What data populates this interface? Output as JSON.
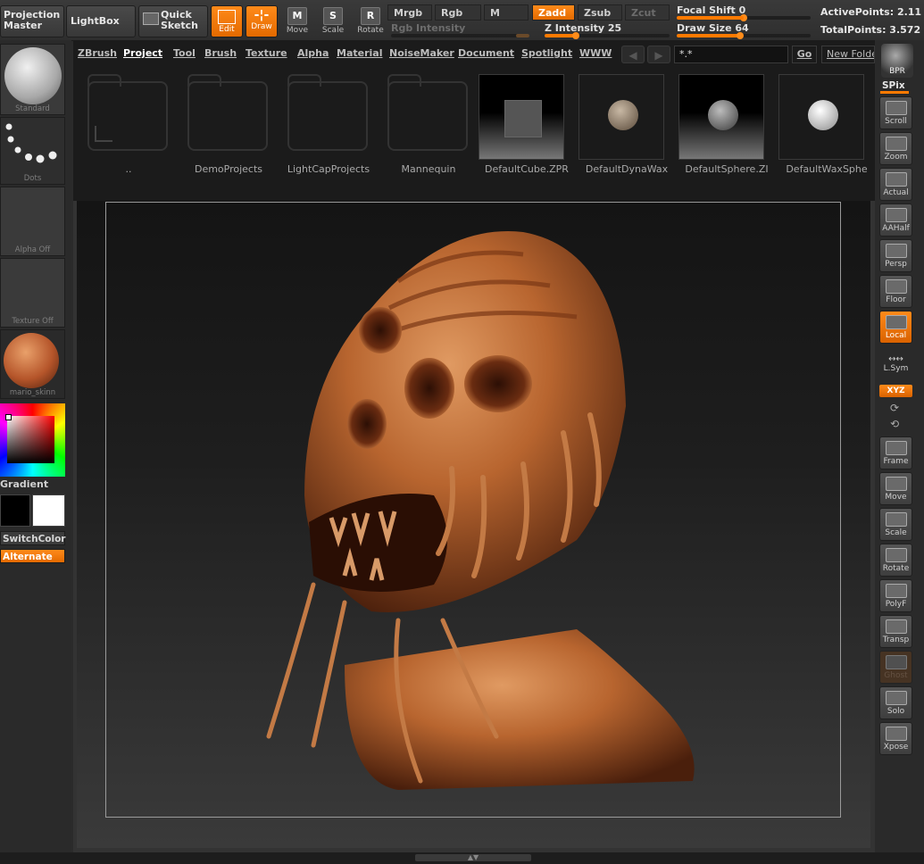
{
  "topbar": {
    "projection_master": "Projection\nMaster",
    "lightbox": "LightBox",
    "quick_sketch": "Quick\nSketch",
    "edit": "Edit",
    "draw": "Draw",
    "move": "Move",
    "scale": "Scale",
    "rotate": "Rotate",
    "move_ic": "M",
    "scale_ic": "S",
    "rotate_ic": "R",
    "mrgb": "Mrgb",
    "rgb": "Rgb",
    "m": "M",
    "zadd": "Zadd",
    "zsub": "Zsub",
    "zcut": "Zcut",
    "rgb_intensity": "Rgb Intensity",
    "z_intensity": "Z Intensity 25",
    "focal_shift": "Focal Shift 0",
    "draw_size": "Draw Size 64",
    "z_intensity_value": 25,
    "focal_shift_value": 0,
    "draw_size_value": 64,
    "active_points": "ActivePoints: 2.11",
    "total_points": "TotalPoints: 3.572",
    "accent": "#ff7a00"
  },
  "left": {
    "brush_label": "Standard",
    "stroke_label": "Dots",
    "alpha_label": "Alpha Off",
    "texture_label": "Texture Off",
    "material_label": "mario_skinn",
    "gradient": "Gradient",
    "switch_color": "SwitchColor",
    "alternate": "Alternate"
  },
  "browser": {
    "menu": [
      "ZBrush",
      "Project",
      "Tool",
      "Brush",
      "Texture",
      "Alpha",
      "Material",
      "NoiseMaker",
      "Document",
      "Spotlight",
      "WWW"
    ],
    "active_menu": "Project",
    "filter": "*.*",
    "go": "Go",
    "new_folder": "New Folde",
    "prev_arrow": "◀",
    "next_arrow": "▶",
    "files": [
      {
        "name": "..",
        "kind": "parent-folder"
      },
      {
        "name": "DemoProjects",
        "kind": "folder"
      },
      {
        "name": "LightCapProjects",
        "kind": "folder"
      },
      {
        "name": "Mannequin",
        "kind": "folder"
      },
      {
        "name": "DefaultCube.ZPR",
        "kind": "cube"
      },
      {
        "name": "DefaultDynaWax",
        "kind": "sphere-tan"
      },
      {
        "name": "DefaultSphere.ZI",
        "kind": "sphere-gray"
      },
      {
        "name": "DefaultWaxSphe",
        "kind": "sphere-white"
      }
    ]
  },
  "right": {
    "bpr": "BPR",
    "spix": "SPix",
    "buttons": [
      {
        "label": "Scroll",
        "icon": "hand-icon",
        "state": "normal"
      },
      {
        "label": "Zoom",
        "icon": "zoom-icon",
        "state": "normal"
      },
      {
        "label": "Actual",
        "icon": "magnifier-icon",
        "state": "normal"
      },
      {
        "label": "AAHalf",
        "icon": "magnifier-icon",
        "state": "normal"
      },
      {
        "label": "Persp",
        "icon": "grid-icon",
        "state": "normal"
      },
      {
        "label": "Floor",
        "icon": "floor-icon",
        "state": "normal"
      },
      {
        "label": "Local",
        "icon": "local-icon",
        "state": "active"
      }
    ],
    "lsym": "L.Sym",
    "xyz": "XYZ",
    "buttons2": [
      {
        "label": "Frame",
        "icon": "frame-icon",
        "state": "normal"
      },
      {
        "label": "Move",
        "icon": "hand-icon",
        "state": "normal"
      },
      {
        "label": "Scale",
        "icon": "scale-icon",
        "state": "normal"
      },
      {
        "label": "Rotate",
        "icon": "rotate-icon",
        "state": "normal"
      },
      {
        "label": "PolyF",
        "icon": "polyframe-icon",
        "state": "normal"
      },
      {
        "label": "Transp",
        "icon": "transparency-icon",
        "state": "normal"
      },
      {
        "label": "Ghost",
        "icon": "ghost-icon",
        "state": "disabled"
      },
      {
        "label": "Solo",
        "icon": "solo-icon",
        "state": "normal"
      },
      {
        "label": "Xpose",
        "icon": "xpose-icon",
        "state": "normal"
      }
    ]
  }
}
